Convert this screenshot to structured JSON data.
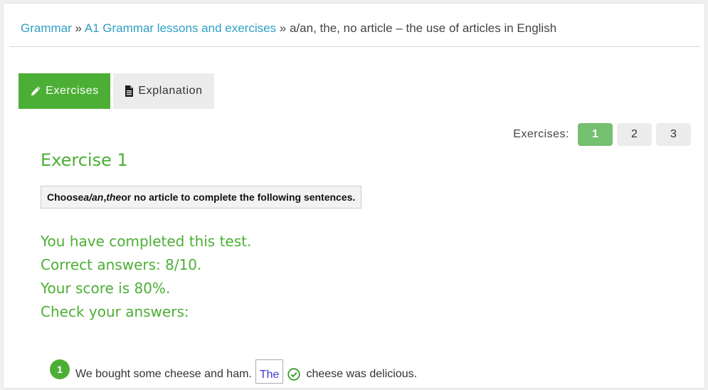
{
  "breadcrumb": {
    "items": [
      "Grammar",
      "A1 Grammar lessons and exercises"
    ],
    "separator": "»",
    "current": "a/an, the, no article – the use of articles in English"
  },
  "tabs": {
    "exercises": "Exercises",
    "explanation": "Explanation",
    "active": "Exercises"
  },
  "exercise_nav": {
    "label": "Exercises:",
    "pages": [
      "1",
      "2",
      "3"
    ],
    "active": "1"
  },
  "exercise": {
    "title": "Exercise 1",
    "instruction": {
      "part1": "Choose ",
      "em1": "a/an",
      "part2": ", ",
      "em2": "the",
      "part3": " or no article to complete the following sentences."
    }
  },
  "result": {
    "line1": "You have completed this test.",
    "line2": "Correct answers: 8/10.",
    "line3": "Your score is 80%.",
    "line4": "Check your answers:"
  },
  "questions": [
    {
      "number": "1",
      "before": "We bought some cheese and ham.",
      "answer": "The",
      "after": "cheese was delicious.",
      "status": "correct"
    }
  ],
  "colors": {
    "accent": "#4caf35",
    "link": "#2f9fc4",
    "active_page": "#75c070",
    "answer_text": "#3b3bd8"
  },
  "icons": {
    "exercises_tab": "pencil-icon",
    "explanation_tab": "document-icon",
    "answer_status": "check-circle-icon"
  }
}
